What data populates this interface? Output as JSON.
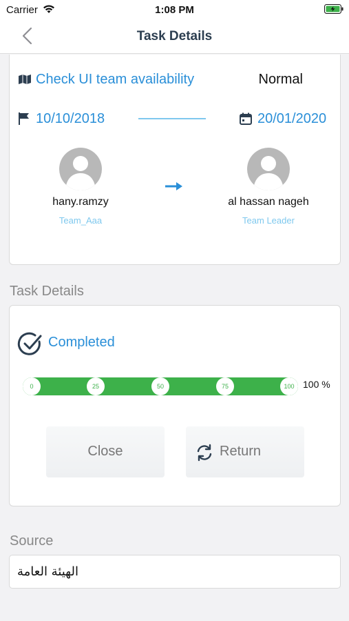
{
  "status_bar": {
    "carrier": "Carrier",
    "time": "1:08 PM"
  },
  "nav": {
    "title": "Task Details",
    "back_icon": "chevron-left-icon"
  },
  "task": {
    "title": "Check UI team availability",
    "priority": "Normal",
    "start_date": "10/10/2018",
    "end_date": "20/01/2020"
  },
  "assignment": {
    "from": {
      "name": "hany.ramzy",
      "role": "Team_Aaa"
    },
    "to": {
      "name": "al hassan nageh",
      "role": "Team Leader"
    }
  },
  "details": {
    "section_label": "Task Details",
    "status": "Completed",
    "progress": {
      "value": 100,
      "label": "100 %",
      "ticks": [
        "0",
        "25",
        "50",
        "75",
        "100"
      ]
    },
    "buttons": {
      "close": "Close",
      "return": "Return"
    }
  },
  "source": {
    "section_label": "Source",
    "value": "الهيئة العامة"
  },
  "colors": {
    "accent": "#2a8fd8",
    "progress": "#3db14a",
    "title": "#2c3e50"
  }
}
